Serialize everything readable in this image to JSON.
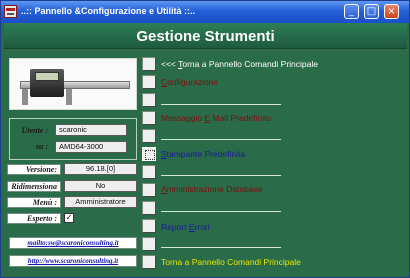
{
  "window": {
    "title": "..:: Pannello &Configurazione e Utilità ::..",
    "buttons": {
      "minimize": "_",
      "maximize": "□",
      "close": "×"
    }
  },
  "header": {
    "title": "Gestione Strumenti"
  },
  "user_panel": {
    "utente_label": "Utente :",
    "utente_value": "scaronic",
    "su_label": "su :",
    "su_value": "AMD64-3000"
  },
  "info": {
    "versione_label": "Versione:",
    "versione_value": "96.18.[0]",
    "ridimensiona_label": "Ridimensiona",
    "ridimensiona_value": "No",
    "menu_label": "Menù :",
    "menu_value": "Amministratore",
    "esperto_label": "Esperto :",
    "esperto_checked": "✓"
  },
  "links": {
    "mail": "mailto:sw@scaroniconsulting.it",
    "web": "http://www.scaroniconsulting.it"
  },
  "menu": {
    "item1": {
      "prefix": "<<< ",
      "under": "T",
      "rest": "orna a Pannello Comandi Principale"
    },
    "item2": {
      "prefix": "",
      "under": "C",
      "rest": "onfigurazione"
    },
    "item3": {
      "prefix": "Messaggio ",
      "under": "E",
      "rest": ".Mail Predefinito"
    },
    "item4": {
      "prefix": "",
      "under": "S",
      "rest": "tampante Predefinita"
    },
    "item5": {
      "prefix": "",
      "under": "A",
      "rest": "mministrazione Database"
    },
    "item6": {
      "prefix": "Report ",
      "under": "E",
      "rest": "rrori"
    },
    "item7": {
      "label": "Torna a Pannello Comandi Principale"
    }
  },
  "colors": {
    "background": "#2a6b49",
    "menu_dark_red": "#7a1010",
    "menu_blue": "#1a1a9a",
    "menu_white": "#ffffff",
    "menu_yellow": "#e8e800"
  }
}
